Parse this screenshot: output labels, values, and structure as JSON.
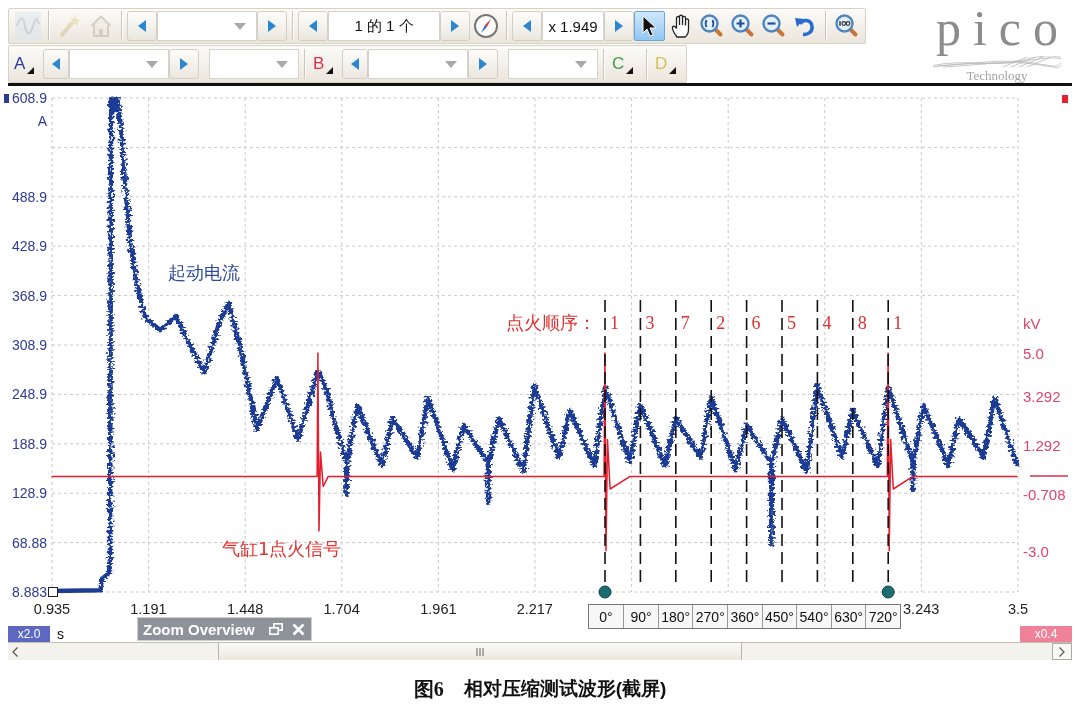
{
  "toolbar": {
    "left_tools": [
      {
        "kind": "wave",
        "disabled": true
      },
      {
        "kind": "wand",
        "disabled": true
      },
      {
        "kind": "home",
        "disabled": true
      }
    ],
    "buffer_field": "1 的 1 个",
    "zoom_field": "x 1.949",
    "tools": [
      {
        "kind": "pointer",
        "selected": true
      },
      {
        "kind": "hand",
        "selected": false
      },
      {
        "kind": "fit",
        "selected": false
      },
      {
        "kind": "zoomin",
        "selected": false
      },
      {
        "kind": "zoomout",
        "selected": false
      },
      {
        "kind": "undo",
        "selected": false
      },
      {
        "kind": "zoom100",
        "selected": false
      }
    ]
  },
  "channels": [
    {
      "label": "A",
      "kind": "full",
      "color": "#2b3aa8"
    },
    {
      "label": "B",
      "kind": "full",
      "color": "#e0304e"
    },
    {
      "label": "C",
      "kind": "short",
      "color": "#3d9e46"
    },
    {
      "label": "D",
      "kind": "short",
      "color": "#d4bf55"
    }
  ],
  "logo": {
    "name": "pico",
    "tagline": "Technology"
  },
  "scope": {
    "chart_data": {
      "type": "line",
      "grid": true,
      "xlabel": "s",
      "ylabel": "A",
      "x": [
        0.935,
        1.063,
        1.068,
        1.086,
        1.089,
        1.092,
        1.097,
        1.102,
        1.108,
        1.118,
        1.129,
        1.142,
        1.158,
        1.182,
        1.222,
        1.264,
        1.301,
        1.339,
        1.381,
        1.405,
        1.442,
        1.479,
        1.532,
        1.588,
        1.639,
        1.641,
        1.644,
        1.648,
        1.655,
        1.668,
        1.684,
        1.716,
        1.717,
        1.719,
        1.745,
        1.811,
        1.839,
        1.905,
        1.933,
        1.999,
        2.027,
        2.092,
        2.093,
        2.095,
        2.121,
        2.187,
        2.215,
        2.281,
        2.309,
        2.375,
        2.401,
        2.403,
        2.406,
        2.41,
        2.417,
        2.469,
        2.497,
        2.563,
        2.591,
        2.657,
        2.685,
        2.751,
        2.779,
        2.844,
        2.845,
        2.847,
        2.873,
        2.939,
        2.967,
        3.033,
        3.061,
        3.127,
        3.153,
        3.155,
        3.158,
        3.162,
        3.169,
        3.22,
        3.221,
        3.223,
        3.249,
        3.315,
        3.343,
        3.409,
        3.437,
        3.497
      ],
      "series": [
        {
          "color": "#1c3b94",
          "values": [
            10,
            11,
            25,
            31,
            48,
            608,
            608,
            594,
            608,
            576,
            503,
            436,
            388,
            342,
            327,
            344,
            309,
            276,
            339,
            360,
            291,
            206,
            269,
            194,
            274,
            276,
            275,
            271,
            264,
            248,
            218,
            168,
            127,
            168,
            236,
            162,
            220,
            172,
            245,
            157,
            212,
            166,
            117,
            166,
            220,
            155,
            260,
            172,
            230,
            162,
            248,
            257,
            253,
            248,
            238,
            167,
            236,
            162,
            220,
            172,
            245,
            157,
            212,
            166,
            66,
            166,
            220,
            155,
            260,
            172,
            230,
            162,
            248,
            257,
            253,
            248,
            238,
            168,
            133,
            168,
            236,
            162,
            220,
            172,
            245,
            164
          ]
        },
        {
          "color": "#e41e2c",
          "values": [
            149,
            149,
            149,
            149,
            149,
            149,
            149,
            149,
            149,
            149,
            149,
            149,
            149,
            149,
            149,
            149,
            149,
            149,
            149,
            149,
            149,
            149,
            149,
            149,
            149,
            299,
            83,
            179,
            137,
            149,
            149,
            149,
            149,
            149,
            149,
            149,
            149,
            149,
            149,
            149,
            149,
            149,
            149,
            149,
            149,
            149,
            149,
            149,
            149,
            149,
            149,
            299,
            59,
            194,
            134,
            149,
            149,
            149,
            149,
            149,
            149,
            149,
            149,
            149,
            149,
            149,
            149,
            149,
            149,
            149,
            149,
            149,
            149,
            299,
            59,
            194,
            134,
            149,
            149,
            149,
            149,
            149,
            149,
            149,
            149,
            149
          ]
        }
      ],
      "xlim": [
        0.935,
        3.5
      ],
      "ylim": [
        8.883,
        608.9
      ],
      "xticks": [
        0.935,
        1.191,
        1.448,
        1.704,
        1.961,
        2.217,
        3.243,
        3.5
      ],
      "yticks": [
        8.883,
        68.88,
        128.9,
        188.9,
        248.9,
        308.9,
        368.9,
        428.9,
        488.9,
        608.9
      ]
    },
    "left_scale": "x2.0",
    "right_axis": {
      "unit": "kV",
      "labels": [
        "5.0",
        "3.292",
        "1.292",
        "-0.708",
        "-3.0"
      ],
      "scale": "x0.4"
    },
    "annotations": [
      {
        "text": "起动电流",
        "color": "#2f4c9c"
      },
      {
        "text": "气缸1点火信号",
        "color": "#e23232"
      }
    ],
    "firing_order": {
      "label": "点火顺序：",
      "cylinders": [
        "1",
        "3",
        "7",
        "2",
        "6",
        "5",
        "4",
        "8",
        "1"
      ]
    },
    "angle_ruler": {
      "marks": [
        "0°",
        "90°",
        "180°",
        "270°",
        "360°",
        "450°",
        "540°",
        "630°",
        "720°"
      ]
    }
  },
  "zoom_overview": {
    "title": "Zoom Overview"
  },
  "caption": {
    "figure": "图6",
    "text": "相对压缩测试波形(截屏)"
  }
}
